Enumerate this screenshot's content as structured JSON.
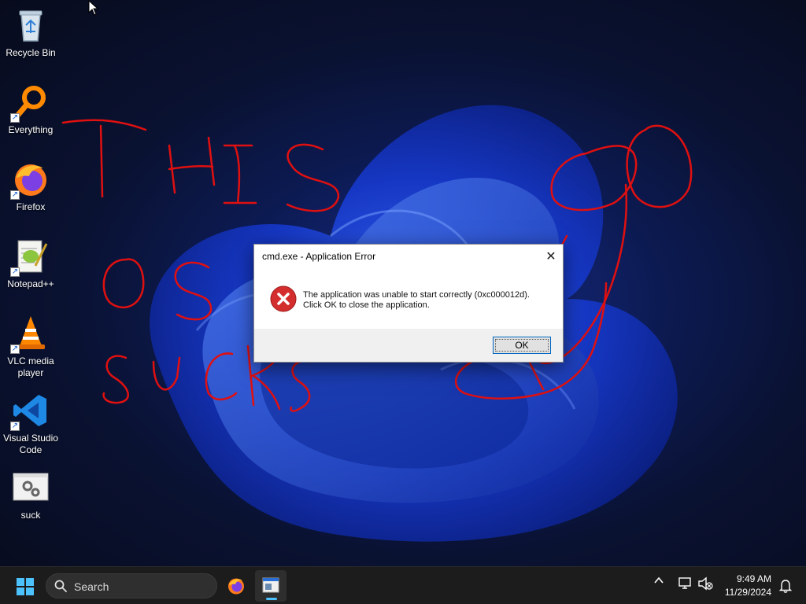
{
  "desktop": {
    "icons": [
      {
        "label": "Recycle Bin",
        "icon": "recycle-bin-icon"
      },
      {
        "label": "Everything",
        "icon": "everything-search-icon"
      },
      {
        "label": "Firefox",
        "icon": "firefox-icon"
      },
      {
        "label": "Notepad++",
        "icon": "notepad-plus-plus-icon"
      },
      {
        "label_line1": "VLC media",
        "label_line2": "player",
        "icon": "vlc-icon"
      },
      {
        "label_line1": "Visual Studio",
        "label_line2": "Code",
        "icon": "vscode-icon"
      },
      {
        "label": "suck",
        "icon": "settings-file-icon"
      }
    ]
  },
  "dialog": {
    "title": "cmd.exe - Application Error",
    "message_line1": "The application was unable to start correctly (0xc000012d).",
    "message_line2": "Click OK to close the application.",
    "ok_label": "OK"
  },
  "taskbar": {
    "search_label": "Search",
    "time": "9:49 AM",
    "date": "11/29/2024",
    "accent": "#4cc2ff"
  },
  "colors": {
    "scribble": "#e01010",
    "error_red": "#d42d2d"
  }
}
